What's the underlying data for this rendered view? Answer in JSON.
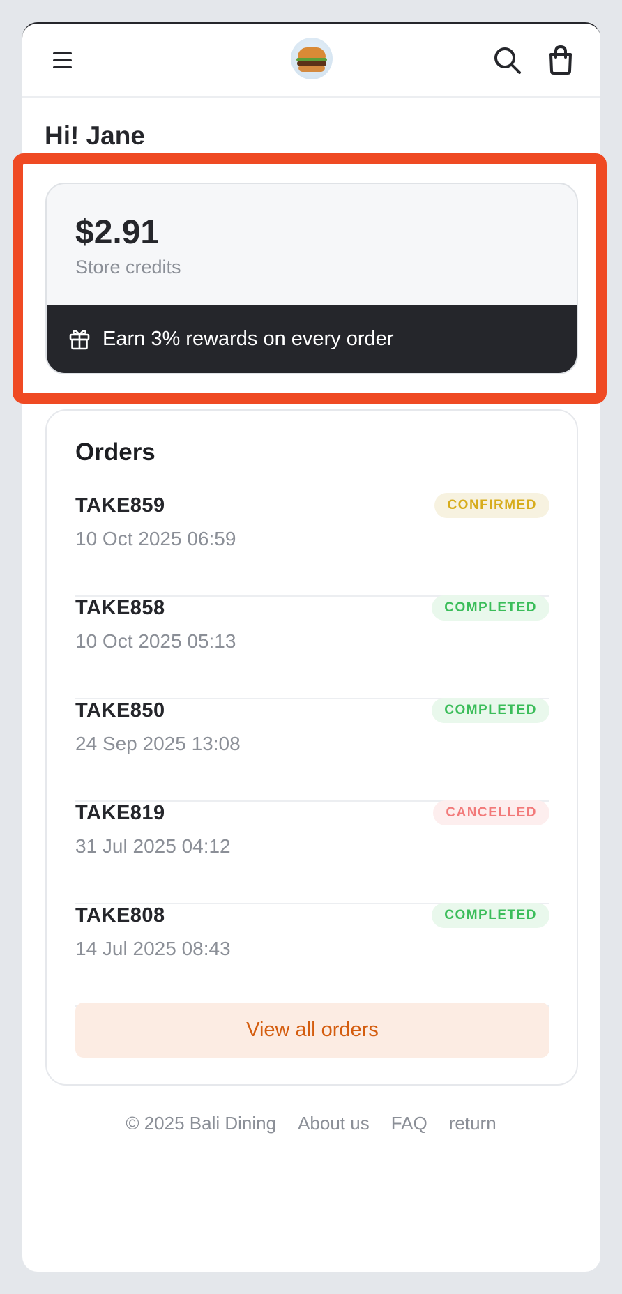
{
  "header": {
    "menu_icon": "hamburger-menu-icon",
    "logo_icon": "burger-logo",
    "search_icon": "search-icon",
    "cart_icon": "shopping-bag-icon"
  },
  "greeting": "Hi! Jane",
  "credits": {
    "amount": "$2.91",
    "label": "Store credits",
    "reward_text": "Earn 3% rewards on every order",
    "reward_icon": "gift-icon"
  },
  "orders": {
    "title": "Orders",
    "items": [
      {
        "id": "TAKE859",
        "date": "10 Oct 2025 06:59",
        "status": "CONFIRMED"
      },
      {
        "id": "TAKE858",
        "date": "10 Oct 2025 05:13",
        "status": "COMPLETED"
      },
      {
        "id": "TAKE850",
        "date": "24 Sep 2025 13:08",
        "status": "COMPLETED"
      },
      {
        "id": "TAKE819",
        "date": "31 Jul 2025 04:12",
        "status": "CANCELLED"
      },
      {
        "id": "TAKE808",
        "date": "14 Jul 2025 08:43",
        "status": "COMPLETED"
      }
    ],
    "view_all_label": "View all orders"
  },
  "footer": {
    "copyright": "© 2025 Bali Dining",
    "links": [
      "About us",
      "FAQ",
      "return"
    ]
  },
  "colors": {
    "highlight": "#ef4a23",
    "dark": "#25262b",
    "confirmed": "#d7ac1c",
    "completed": "#3bbd5a",
    "cancelled": "#f27a7a",
    "accent": "#d45d0f"
  }
}
